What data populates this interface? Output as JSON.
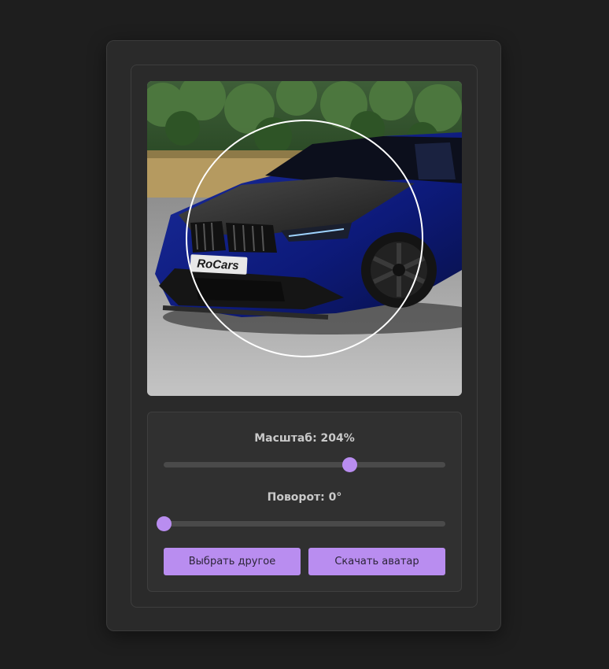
{
  "editor": {
    "zoom_label": "Масштаб: 204%",
    "zoom_fraction": 0.66,
    "rotate_label": "Поворот: 0°",
    "rotate_fraction": 0.0,
    "choose_button": "Выбрать другое",
    "download_button": "Скачать аватар",
    "watermark": "RoCars"
  },
  "colors": {
    "accent": "#b98df0",
    "background": "#1e1e1e",
    "card": "#2a2a2a",
    "panel": "#303030"
  }
}
